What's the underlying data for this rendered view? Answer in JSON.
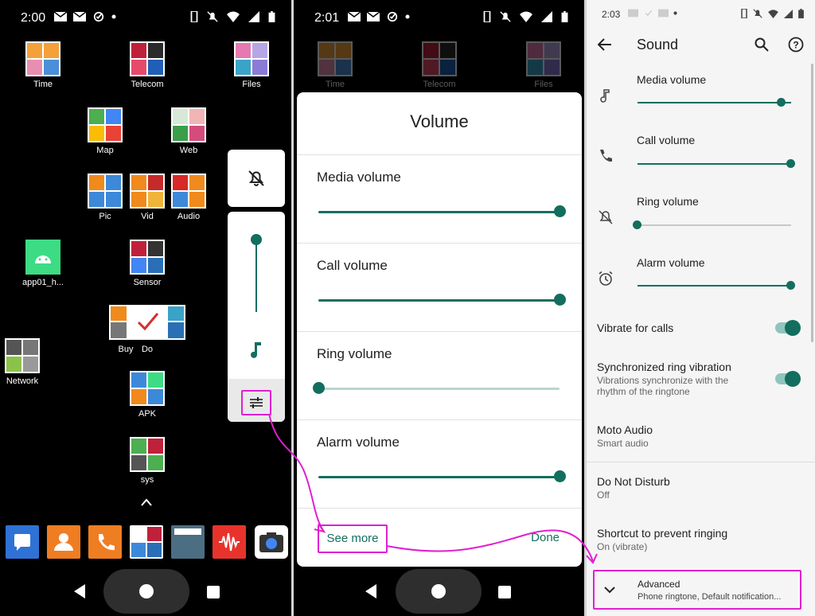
{
  "colors": {
    "accent": "#136e5f",
    "highlight": "#e01fd1",
    "dim_bg": "#000000",
    "settings_bg": "#f5f5f5"
  },
  "screen1": {
    "status_time": "2:00",
    "apps": [
      {
        "label": "Time"
      },
      {
        "label": "Telecom"
      },
      {
        "label": "Files"
      },
      {
        "label": "Map"
      },
      {
        "label": "Web"
      },
      {
        "label": "Pic"
      },
      {
        "label": "Vid"
      },
      {
        "label": "Audio"
      },
      {
        "label": "app01_h..."
      },
      {
        "label": "Sensor"
      },
      {
        "label": "Buy"
      },
      {
        "label": "Do"
      },
      {
        "label": "Network"
      },
      {
        "label": "APK"
      },
      {
        "label": "sys"
      }
    ],
    "dock_icons": [
      "messages-icon",
      "contacts-icon",
      "phone-icon",
      "tools-icon",
      "dashcam-icon",
      "recorder-icon",
      "camera-icon"
    ]
  },
  "screen2": {
    "status_time": "2:01",
    "dim_apps": [
      {
        "label": "Time"
      },
      {
        "label": "Telecom"
      },
      {
        "label": "Files"
      }
    ],
    "dialog": {
      "title": "Volume",
      "rows": [
        {
          "label": "Media volume",
          "level": 1.0
        },
        {
          "label": "Call volume",
          "level": 1.0
        },
        {
          "label": "Ring volume",
          "level": 0.0
        },
        {
          "label": "Alarm volume",
          "level": 1.0
        }
      ],
      "see_more": "See more",
      "done": "Done"
    }
  },
  "screen3": {
    "status_time": "2:03",
    "title": "Sound",
    "sliders": [
      {
        "label": "Media volume",
        "icon": "music-note-icon",
        "level": 0.93
      },
      {
        "label": "Call volume",
        "icon": "phone-icon",
        "level": 1.0
      },
      {
        "label": "Ring volume",
        "icon": "bell-off-icon",
        "level": 0.0
      },
      {
        "label": "Alarm volume",
        "icon": "alarm-icon",
        "level": 1.0
      }
    ],
    "vibrate_for_calls": "Vibrate for calls",
    "sync_vibration": {
      "title": "Synchronized ring vibration",
      "summary": "Vibrations synchronize with the rhythm of the ringtone"
    },
    "moto_audio": {
      "title": "Moto Audio",
      "summary": "Smart audio"
    },
    "dnd": {
      "title": "Do Not Disturb",
      "summary": "Off"
    },
    "shortcut": {
      "title": "Shortcut to prevent ringing",
      "summary": "On (vibrate)"
    },
    "advanced": {
      "title": "Advanced",
      "summary": "Phone ringtone, Default notification..."
    }
  }
}
